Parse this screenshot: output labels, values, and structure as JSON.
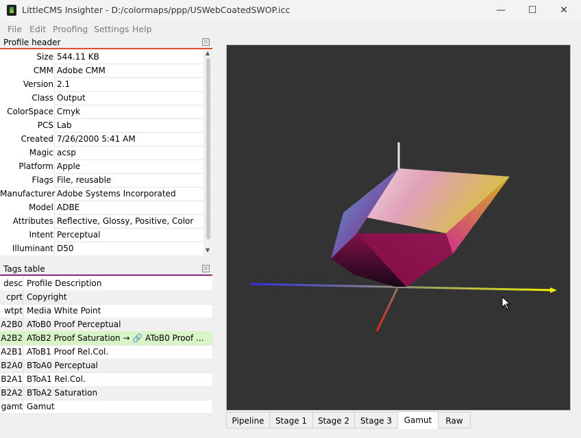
{
  "window": {
    "title": "LittleCMS Insighter - D:/colormaps/ppp/USWebCoatedSWOP.icc",
    "buttons": {
      "minimize": "—",
      "maximize": "☐",
      "close": "✕"
    }
  },
  "menu": [
    {
      "label": "File"
    },
    {
      "label": "Edit"
    },
    {
      "label": "Proofing"
    },
    {
      "label": "Settings"
    },
    {
      "label": "Help"
    }
  ],
  "profile_header": {
    "title": "Profile header",
    "accent_color": "#e0522d",
    "rows": [
      {
        "key": "Size",
        "value": "544.11 KB"
      },
      {
        "key": "CMM",
        "value": "Adobe CMM"
      },
      {
        "key": "Version",
        "value": "2.1"
      },
      {
        "key": "Class",
        "value": "Output"
      },
      {
        "key": "ColorSpace",
        "value": "Cmyk"
      },
      {
        "key": "PCS",
        "value": "Lab"
      },
      {
        "key": "Created",
        "value": "7/26/2000 5:41 AM"
      },
      {
        "key": "Magic",
        "value": "acsp"
      },
      {
        "key": "Platform",
        "value": "Apple"
      },
      {
        "key": "Flags",
        "value": "File, reusable"
      },
      {
        "key": "Manufacturer",
        "value": "Adobe Systems Incorporated"
      },
      {
        "key": "Model",
        "value": "ADBE"
      },
      {
        "key": "Attributes",
        "value": "Reflective, Glossy, Positive, Color"
      },
      {
        "key": "Intent",
        "value": "Perceptual"
      },
      {
        "key": "Illuminant",
        "value": "D50"
      }
    ]
  },
  "tags_table": {
    "title": "Tags table",
    "accent_color": "#8a2a7a",
    "selected_color": "#d8f5c8",
    "rows": [
      {
        "key": "desc",
        "value": "Profile Description"
      },
      {
        "key": "cprt",
        "value": "Copyright"
      },
      {
        "key": "wtpt",
        "value": "Media White Point"
      },
      {
        "key": "A2B0",
        "value": "AToB0 Proof Perceptual"
      },
      {
        "key": "A2B2",
        "value": "AToB2 Proof Saturation → 🔗 AToB0 Proof ...",
        "selected": true
      },
      {
        "key": "A2B1",
        "value": "AToB1 Proof Rel.Col."
      },
      {
        "key": "B2A0",
        "value": "BToA0 Perceptual"
      },
      {
        "key": "B2A1",
        "value": "BToA1 Rel.Col."
      },
      {
        "key": "B2A2",
        "value": "BToA2 Saturation"
      },
      {
        "key": "gamt",
        "value": "Gamut"
      }
    ]
  },
  "view_tabs": [
    {
      "label": "Pipeline"
    },
    {
      "label": "Stage 1"
    },
    {
      "label": "Stage 2"
    },
    {
      "label": "Stage 3"
    },
    {
      "label": "Gamut",
      "active": true
    },
    {
      "label": "Raw"
    }
  ],
  "viewport": {
    "background": "#333333",
    "content": "gamut-3d-solid"
  }
}
